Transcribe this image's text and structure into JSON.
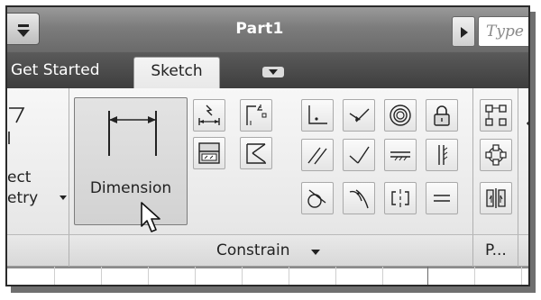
{
  "window": {
    "title": "Part1"
  },
  "search": {
    "placeholder": "Type a"
  },
  "tabs": [
    {
      "label": "Get Started",
      "active": false
    },
    {
      "label": "Sketch",
      "active": true
    }
  ],
  "ribbon": {
    "partial_left_label_line1": "ect",
    "partial_left_label_line2": "etry",
    "dimension_button": {
      "label": "Dimension",
      "icon": "dimension-icon"
    },
    "small_tools": [
      {
        "name": "auto-dimension-icon"
      },
      {
        "name": "show-constraints-icon"
      },
      {
        "name": "automatic-constraints-icon"
      },
      {
        "name": "constraint-settings-icon"
      }
    ],
    "constraint_tools": [
      {
        "name": "coincident-constraint-icon"
      },
      {
        "name": "collinear-constraint-icon"
      },
      {
        "name": "concentric-constraint-icon"
      },
      {
        "name": "fix-constraint-icon"
      },
      {
        "name": "parallel-constraint-icon"
      },
      {
        "name": "perpendicular-constraint-icon"
      },
      {
        "name": "horizontal-constraint-icon"
      },
      {
        "name": "vertical-constraint-icon"
      },
      {
        "name": "tangent-constraint-icon"
      },
      {
        "name": "smooth-constraint-icon"
      },
      {
        "name": "symmetric-constraint-icon"
      },
      {
        "name": "equal-constraint-icon"
      }
    ],
    "pattern_tools": [
      {
        "name": "rectangular-pattern-icon"
      },
      {
        "name": "circular-pattern-icon"
      },
      {
        "name": "mirror-icon"
      }
    ]
  },
  "panels": {
    "constrain": "Constrain",
    "pattern": "P..."
  },
  "colors": {
    "titlebar": "#7c7c7c",
    "tabbar": "#4a4a4a",
    "ribbon": "#eeeeee",
    "icon_stroke": "#222222"
  }
}
